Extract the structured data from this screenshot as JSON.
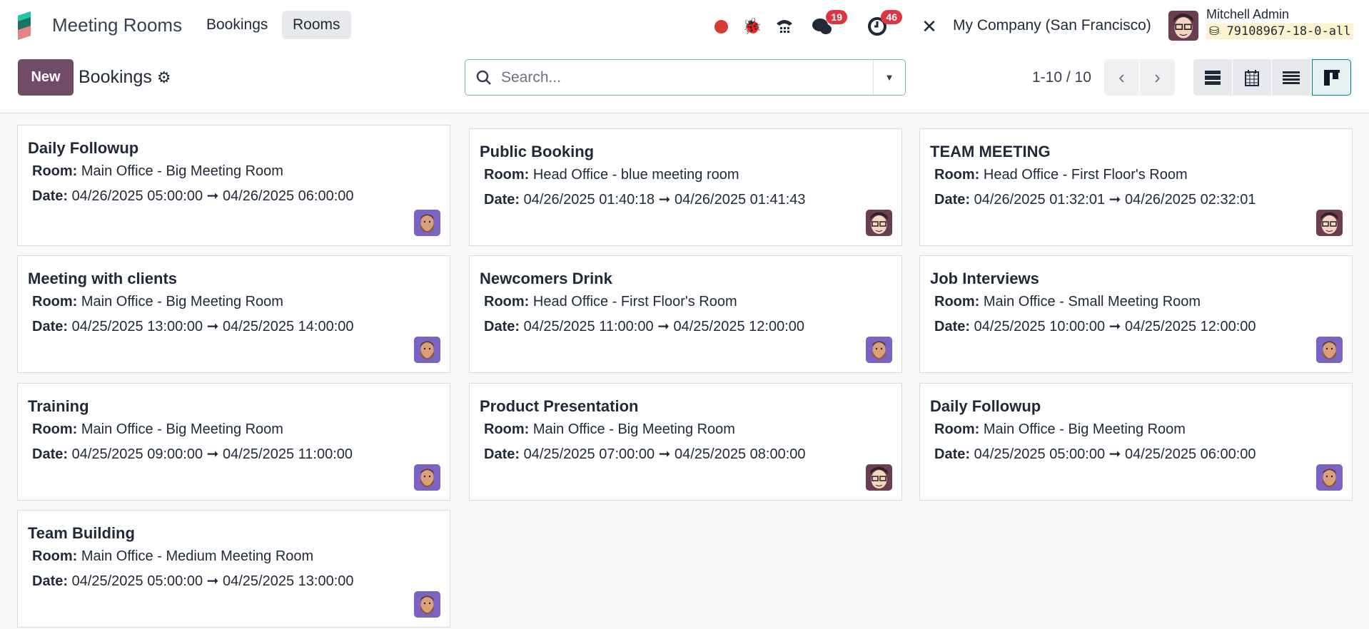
{
  "app": {
    "name": "Meeting Rooms",
    "menu": [
      "Bookings",
      "Rooms"
    ],
    "active_menu": "Rooms"
  },
  "systray": {
    "messages_count": "19",
    "activities_count": "46",
    "company": "My Company (San Francisco)",
    "user": "Mitchell Admin",
    "database": "79108967-18-0-all"
  },
  "control": {
    "new_label": "New",
    "title": "Bookings",
    "search_placeholder": "Search...",
    "pager": "1-10 / 10"
  },
  "labels": {
    "room": "Room:",
    "date": "Date:",
    "arrow": "➞"
  },
  "colors": {
    "brand": "#714b67",
    "badge": "#dc3545",
    "accent": "#017e84"
  },
  "cards": [
    {
      "title": "Daily Followup",
      "room": "Main Office - Big Meeting Room",
      "start": "04/26/2025 05:00:00",
      "end": "04/26/2025 06:00:00",
      "avatar": "bearded-user"
    },
    {
      "title": "Public Booking",
      "room": "Head Office - blue meeting room",
      "start": "04/26/2025 01:40:18",
      "end": "04/26/2025 01:41:43",
      "avatar": "mitchell-admin"
    },
    {
      "title": "TEAM MEETING",
      "room": "Head Office - First Floor's Room",
      "start": "04/26/2025 01:32:01",
      "end": "04/26/2025 02:32:01",
      "avatar": "mitchell-admin"
    },
    {
      "title": "Meeting with clients",
      "room": "Main Office - Big Meeting Room",
      "start": "04/25/2025 13:00:00",
      "end": "04/25/2025 14:00:00",
      "avatar": "bearded-user"
    },
    {
      "title": "Newcomers Drink",
      "room": "Head Office - First Floor's Room",
      "start": "04/25/2025 11:00:00",
      "end": "04/25/2025 12:00:00",
      "avatar": "bearded-user"
    },
    {
      "title": "Job Interviews",
      "room": "Main Office - Small Meeting Room",
      "start": "04/25/2025 10:00:00",
      "end": "04/25/2025 12:00:00",
      "avatar": "bearded-user"
    },
    {
      "title": "Training",
      "room": "Main Office - Big Meeting Room",
      "start": "04/25/2025 09:00:00",
      "end": "04/25/2025 11:00:00",
      "avatar": "bearded-user"
    },
    {
      "title": "Product Presentation",
      "room": "Main Office - Big Meeting Room",
      "start": "04/25/2025 07:00:00",
      "end": "04/25/2025 08:00:00",
      "avatar": "mitchell-admin"
    },
    {
      "title": "Daily Followup",
      "room": "Main Office - Big Meeting Room",
      "start": "04/25/2025 05:00:00",
      "end": "04/25/2025 06:00:00",
      "avatar": "bearded-user"
    },
    {
      "title": "Team Building",
      "room": "Main Office - Medium Meeting Room",
      "start": "04/25/2025 05:00:00",
      "end": "04/25/2025 13:00:00",
      "avatar": "bearded-user"
    }
  ]
}
